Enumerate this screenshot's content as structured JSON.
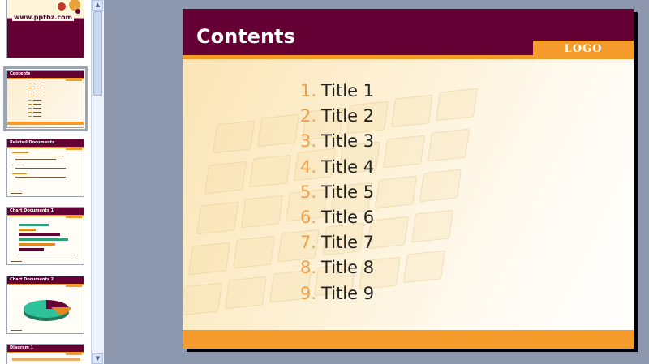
{
  "thumbnails": {
    "slide1": {
      "url_text": "www.pptbz.com"
    },
    "slide2": {
      "title": "Contents"
    },
    "slide3": {
      "title": "Related Documents"
    },
    "slide4": {
      "title": "Chart Documents 1"
    },
    "slide5": {
      "title": "Chart Documents 2"
    },
    "slide6": {
      "title": "Diagram 1"
    }
  },
  "slide": {
    "title": "Contents",
    "logo": "LOGO",
    "items": [
      {
        "num": "1.",
        "text": "Title 1"
      },
      {
        "num": "2.",
        "text": "Title 2"
      },
      {
        "num": "3.",
        "text": "Title 3"
      },
      {
        "num": "4.",
        "text": "Title 4"
      },
      {
        "num": "5.",
        "text": "Title 5"
      },
      {
        "num": "6.",
        "text": "Title 6"
      },
      {
        "num": "7.",
        "text": "Title 7"
      },
      {
        "num": "8.",
        "text": "Title 8"
      },
      {
        "num": "9.",
        "text": "Title 9"
      }
    ]
  },
  "colors": {
    "header": "#650034",
    "accent": "#f59b2b",
    "number": "#f0a04a",
    "workspace": "#8d97ad"
  }
}
